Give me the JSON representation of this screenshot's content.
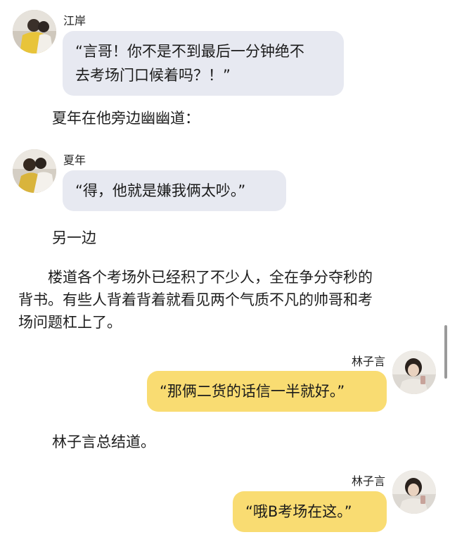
{
  "messages": [
    {
      "speaker": "江岸",
      "text_lines": [
        "“言哥！你不是不到最后一分钟绝不",
        "去考场门口候着吗？！”"
      ]
    },
    {
      "speaker": "夏年",
      "text": "“得，他就是嫌我俩太吵。”"
    },
    {
      "speaker": "林子言",
      "text": "“那俩二货的话信一半就好。”"
    },
    {
      "speaker": "林子言",
      "text": "“哦B考场在这。”"
    }
  ],
  "narration": {
    "n1": "夏年在他旁边幽幽道：",
    "n2": "另一边",
    "paragraph_lines": [
      "　　楼道各个考场外已经积了不少人，全在争分夺秒的",
      "背书。有些人背着背着就看见两个气质不凡的帅哥和考",
      "场问题杠上了。"
    ],
    "n3": "林子言总结道。"
  },
  "colors": {
    "left_bubble": "#e7e9f1",
    "right_bubble": "#f9dc72"
  }
}
